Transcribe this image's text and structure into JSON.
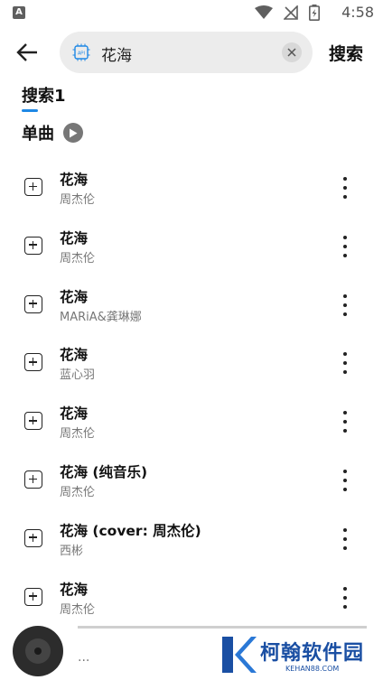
{
  "status_bar": {
    "notification_glyph": "A",
    "time": "4:58"
  },
  "header": {
    "search_query": "花海",
    "search_button_label": "搜索"
  },
  "tab": {
    "label": "搜索1"
  },
  "section": {
    "title": "单曲"
  },
  "songs": [
    {
      "title": "花海",
      "artist": "周杰伦"
    },
    {
      "title": "花海",
      "artist": "周杰伦"
    },
    {
      "title": "花海",
      "artist": "MARiA&龚琳娜"
    },
    {
      "title": "花海",
      "artist": "蓝心羽"
    },
    {
      "title": "花海",
      "artist": "周杰伦"
    },
    {
      "title": "花海 (纯音乐)",
      "artist": "周杰伦"
    },
    {
      "title": "花海 (cover: 周杰伦)",
      "artist": "西彬"
    },
    {
      "title": "花海",
      "artist": "周杰伦"
    }
  ],
  "player": {
    "now_playing": "..."
  },
  "watermark": {
    "text": "柯翰软件园",
    "sub": "KEHAN88.COM"
  },
  "colors": {
    "accent": "#1e88e5",
    "watermark": "#1a4fa3"
  },
  "icons": [
    "back-arrow-icon",
    "app-icon",
    "clear-icon",
    "play-icon",
    "add-icon",
    "more-vert-icon",
    "disc-icon",
    "wifi-icon",
    "no-signal-icon",
    "battery-icon"
  ]
}
